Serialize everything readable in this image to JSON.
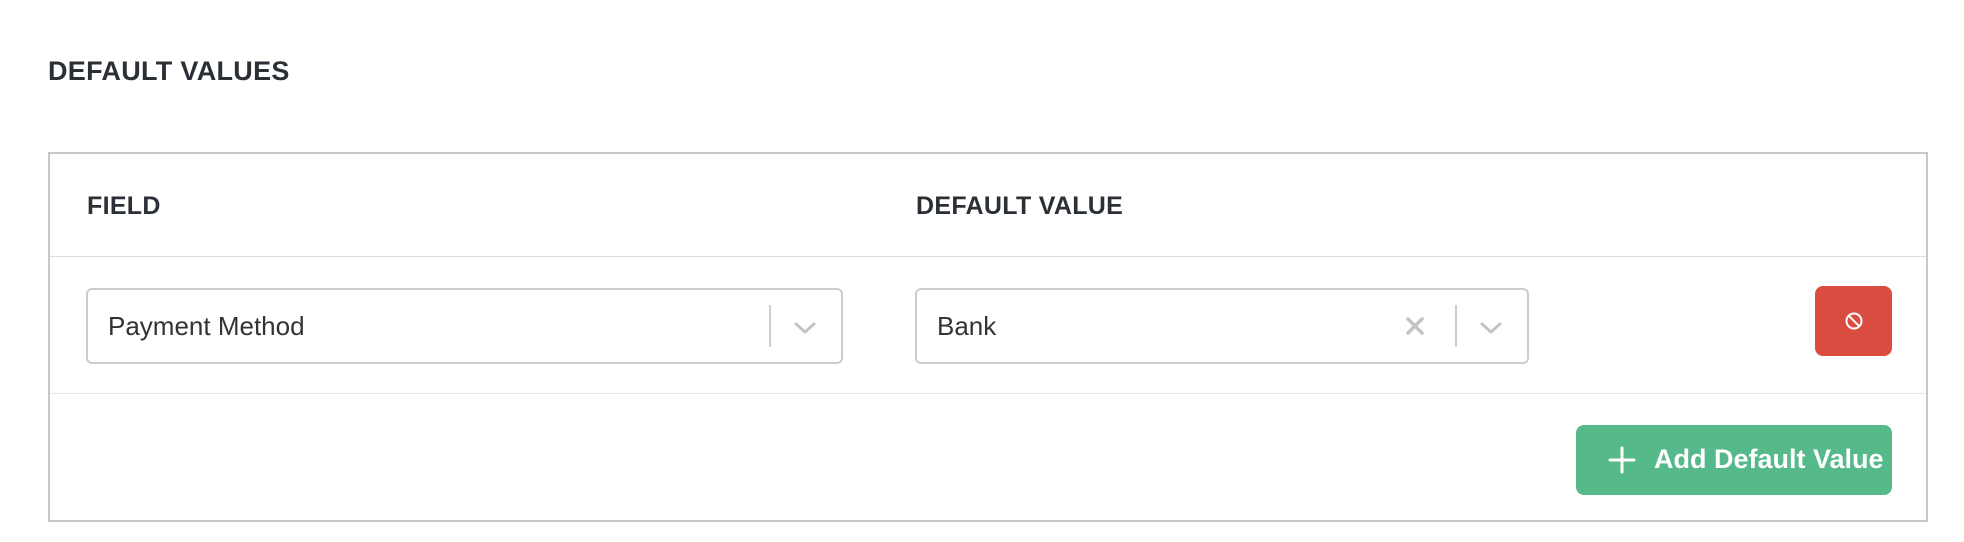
{
  "section": {
    "title": "DEFAULT VALUES"
  },
  "table": {
    "headers": {
      "field": "FIELD",
      "default_value": "DEFAULT VALUE"
    },
    "rows": [
      {
        "field": "Payment Method",
        "default_value": "Bank"
      }
    ]
  },
  "actions": {
    "add_label": "Add Default Value"
  },
  "colors": {
    "delete": "#d94c3f",
    "add": "#55b98a",
    "border": "#c8c8c8"
  },
  "icons": {
    "delete": "ban-icon",
    "add": "plus-icon",
    "dropdown": "chevron-down-icon",
    "clear": "close-icon"
  }
}
